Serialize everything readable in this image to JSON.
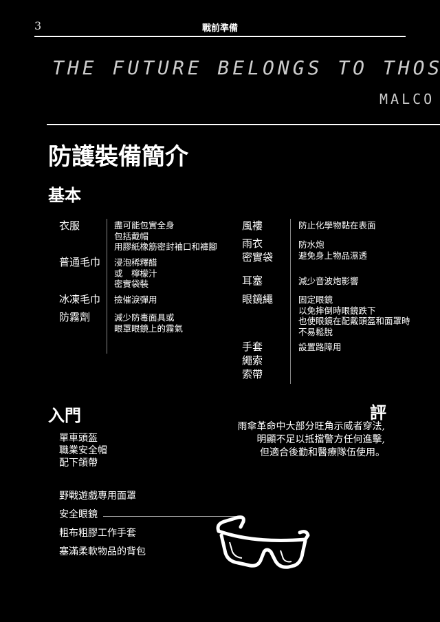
{
  "header": {
    "page_number": "3",
    "title": "戰前準備"
  },
  "quote": {
    "text": "THE FUTURE BELONGS TO THOS",
    "attribution": "MALCO"
  },
  "section_title": "防護裝備簡介",
  "basic": {
    "heading": "基本",
    "left": [
      {
        "term": "衣服",
        "desc": "盡可能包實全身\n包括戴帽\n用膠紙橡筋密封袖口和褲腳"
      },
      {
        "term": "普通毛巾",
        "desc": "浸泡稀釋醋\n或　檸檬汁\n密實袋裝"
      },
      {
        "term": "冰凍毛巾",
        "desc": "撿催淚彈用"
      },
      {
        "term": "防霧劑",
        "desc": "減少防毒面具或\n眼罩眼鏡上的霧氣"
      }
    ],
    "right": [
      {
        "term": "風褸",
        "desc": "防止化學物黏在表面"
      },
      {
        "term": "雨衣\n密實袋",
        "desc": "防水炮\n避免身上物品濕透"
      },
      {
        "term": "耳塞",
        "desc": "減少音波炮影響"
      },
      {
        "term": "眼鏡繩",
        "desc": "固定眼鏡\n以免摔倒時眼鏡跌下\n也使眼鏡在配戴頭盔和面罩時\n不易鬆脫"
      },
      {
        "term": "手套\n繩索\n索帶",
        "desc": "設置路障用"
      }
    ]
  },
  "entry": {
    "heading": "入門",
    "group1": [
      "單車頭盔",
      "職業安全帽",
      "配下頜帶"
    ],
    "group2": [
      "野戰遊戲專用面罩",
      "安全眼鏡",
      "粗布粗膠工作手套",
      "塞滿柔軟物品的背包"
    ]
  },
  "comment": {
    "title": "評",
    "lines": [
      "雨傘革命中大部分旺角示威者穿法,",
      "明顯不足以抵擋警方任何進擊,",
      "但適合後勤和醫療隊伍使用。"
    ]
  },
  "illustration": {
    "icon": "safety-goggles-icon",
    "colors": {
      "background": "#000000",
      "foreground": "#ffffff"
    }
  }
}
